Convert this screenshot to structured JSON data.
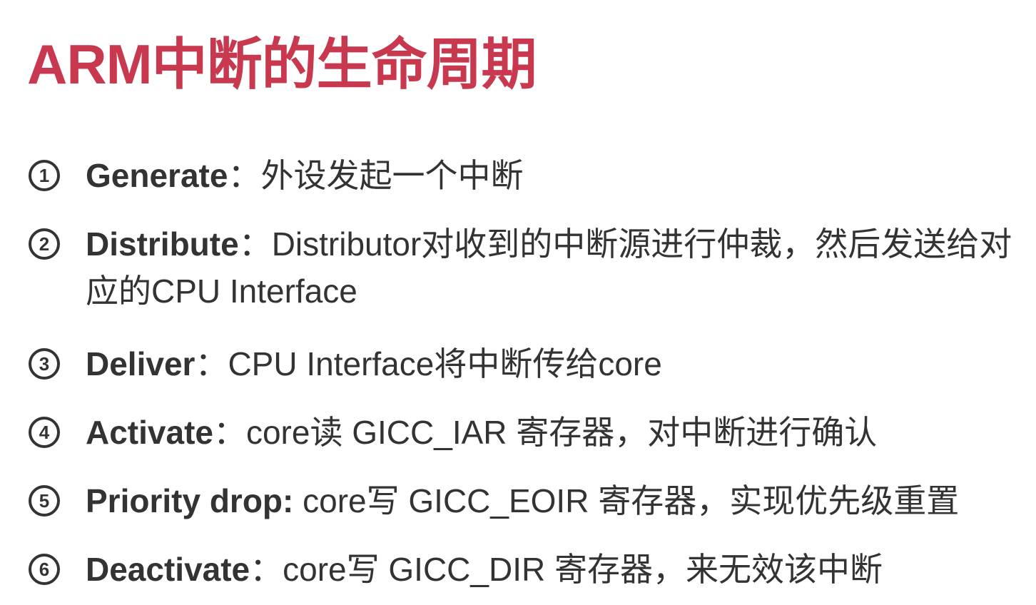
{
  "title": "ARM中断的生命周期",
  "steps": [
    {
      "number": "1",
      "term": "Generate",
      "separator": "：",
      "description": "外设发起一个中断"
    },
    {
      "number": "2",
      "term": "Distribute",
      "separator": "：",
      "description": "Distributor对收到的中断源进行仲裁，然后发送给对应的CPU Interface"
    },
    {
      "number": "3",
      "term": "Deliver",
      "separator": "：",
      "description": "CPU Interface将中断传给core"
    },
    {
      "number": "4",
      "term": "Activate",
      "separator": "：",
      "description": "core读 GICC_IAR 寄存器，对中断进行确认"
    },
    {
      "number": "5",
      "term": "Priority drop:",
      "separator": " ",
      "description": "core写 GICC_EOIR 寄存器，实现优先级重置"
    },
    {
      "number": "6",
      "term": "Deactivate",
      "separator": "：",
      "description": "core写 GICC_DIR 寄存器，来无效该中断"
    }
  ],
  "colors": {
    "title": "#c8384e",
    "text": "#333333",
    "background": "#ffffff"
  },
  "icons": {
    "number_badge": "circled-number-icon"
  }
}
